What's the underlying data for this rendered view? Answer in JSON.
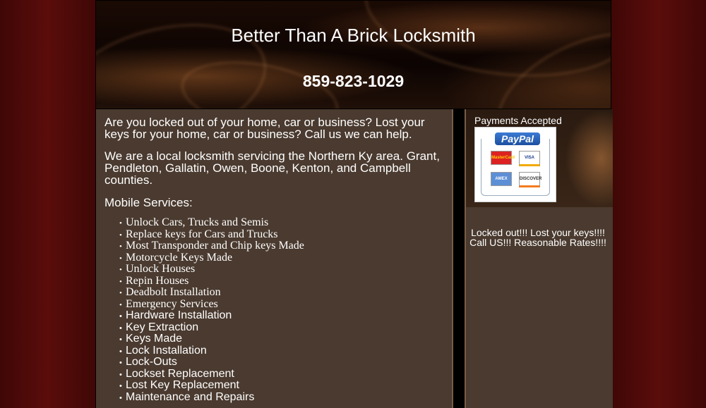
{
  "header": {
    "title": "Better Than A Brick Locksmith",
    "phone": "859-823-1029"
  },
  "main": {
    "intro": "Are you locked out of your home, car or business? Lost your keys for your home, car or business? Call us we can help.",
    "area": "We are a local locksmith servicing the Northern Ky area. Grant, Pendleton, Gallatin, Owen, Boone, Kenton, and Campbell counties.",
    "services_heading": "Mobile Services:",
    "services": [
      "Unlock Cars, Trucks and Semis",
      "Replace keys for Cars and Trucks",
      "Most Transponder and Chip keys Made",
      "Motorcycle Keys Made",
      "Unlock Houses",
      "Repin Houses",
      "Deadbolt Installation",
      "Emergency Services",
      "Hardware Installation",
      "Key Extraction",
      "Keys Made",
      "Lock Installation",
      "Lock-Outs",
      "Lockset Replacement",
      "Lost Key Replacement",
      "Maintenance and Repairs"
    ]
  },
  "sidebar": {
    "payments_label": "Payments Accepted",
    "paypal": "PayPal",
    "cards": [
      "MasterCard",
      "VISA",
      "AMEX",
      "DISCOVER"
    ],
    "message": "Locked out!!! Lost your keys!!!! Call US!!! Reasonable Rates!!!!"
  },
  "colors": {
    "side_background": "#4a0a08",
    "content_background": "#4a3a2f",
    "border_accent": "#7a5c45"
  }
}
